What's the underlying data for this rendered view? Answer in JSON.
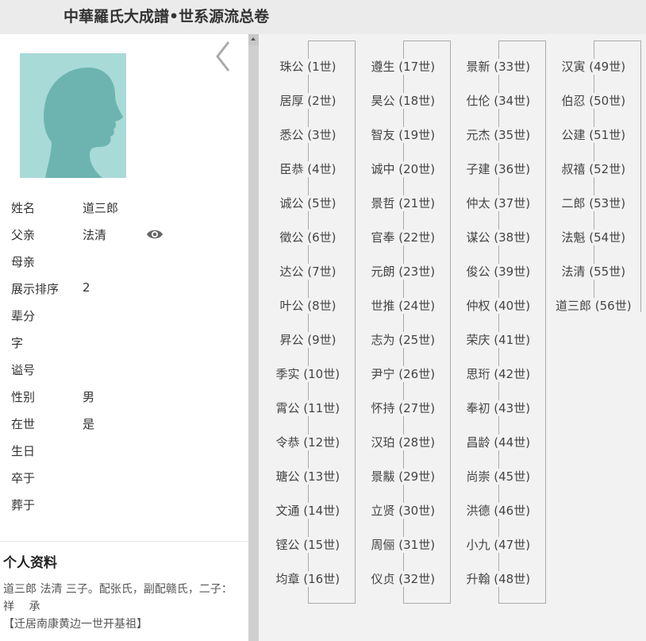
{
  "header": {
    "title": "中華羅氏大成譜•世系源流总卷"
  },
  "person": {
    "fields": [
      {
        "label": "姓名",
        "value": "道三郎"
      },
      {
        "label": "父亲",
        "value": "法清"
      },
      {
        "label": "母亲",
        "value": ""
      },
      {
        "label": "展示排序",
        "value": "2"
      },
      {
        "label": "辈分",
        "value": ""
      },
      {
        "label": "字",
        "value": ""
      },
      {
        "label": "谥号",
        "value": ""
      },
      {
        "label": "性别",
        "value": "男"
      },
      {
        "label": "在世",
        "value": "是"
      },
      {
        "label": "生日",
        "value": ""
      },
      {
        "label": "卒于",
        "value": ""
      },
      {
        "label": "葬于",
        "value": ""
      }
    ]
  },
  "bio": {
    "heading": "个人资料",
    "text": "道三郎 法清 三子。配张氏，副配赣氏，二子： 祥　 承\n【迁居南康黄边一世开基祖】"
  },
  "generations": [
    [
      "珠公 (1世)",
      "居厚 (2世)",
      "悉公 (3世)",
      "臣恭 (4世)",
      "诚公 (5世)",
      "徵公 (6世)",
      "达公 (7世)",
      "叶公 (8世)",
      "昇公 (9世)",
      "季实 (10世)",
      "霄公 (11世)",
      "令恭 (12世)",
      "瑭公 (13世)",
      "文通 (14世)",
      "铿公 (15世)",
      "均章 (16世)"
    ],
    [
      "遵生 (17世)",
      "昊公 (18世)",
      "智友 (19世)",
      "诚中 (20世)",
      "景哲 (21世)",
      "官奉 (22世)",
      "元朗 (23世)",
      "世推 (24世)",
      "志为 (25世)",
      "尹宁 (26世)",
      "怀持 (27世)",
      "汉珀 (28世)",
      "景黻 (29世)",
      "立贤 (30世)",
      "周俪 (31世)",
      "仪贞 (32世)"
    ],
    [
      "景新 (33世)",
      "仕伦 (34世)",
      "元杰 (35世)",
      "子建 (36世)",
      "仲太 (37世)",
      "谋公 (38世)",
      "俊公 (39世)",
      "仲权 (40世)",
      "荣庆 (41世)",
      "思珩 (42世)",
      "奉初 (43世)",
      "昌龄 (44世)",
      "尚崇 (45世)",
      "洪德 (46世)",
      "小九 (47世)",
      "升翰 (48世)"
    ],
    [
      "汉寅 (49世)",
      "伯忍 (50世)",
      "公建 (51世)",
      "叔禧 (52世)",
      "二郎 (53世)",
      "法魁 (54世)",
      "法清 (55世)",
      "道三郎 (56世)"
    ]
  ],
  "colors": {
    "avatar_bg": "#a8dad8",
    "silhouette": "#6db4b0",
    "panel_bg": "#f2f2f2"
  }
}
